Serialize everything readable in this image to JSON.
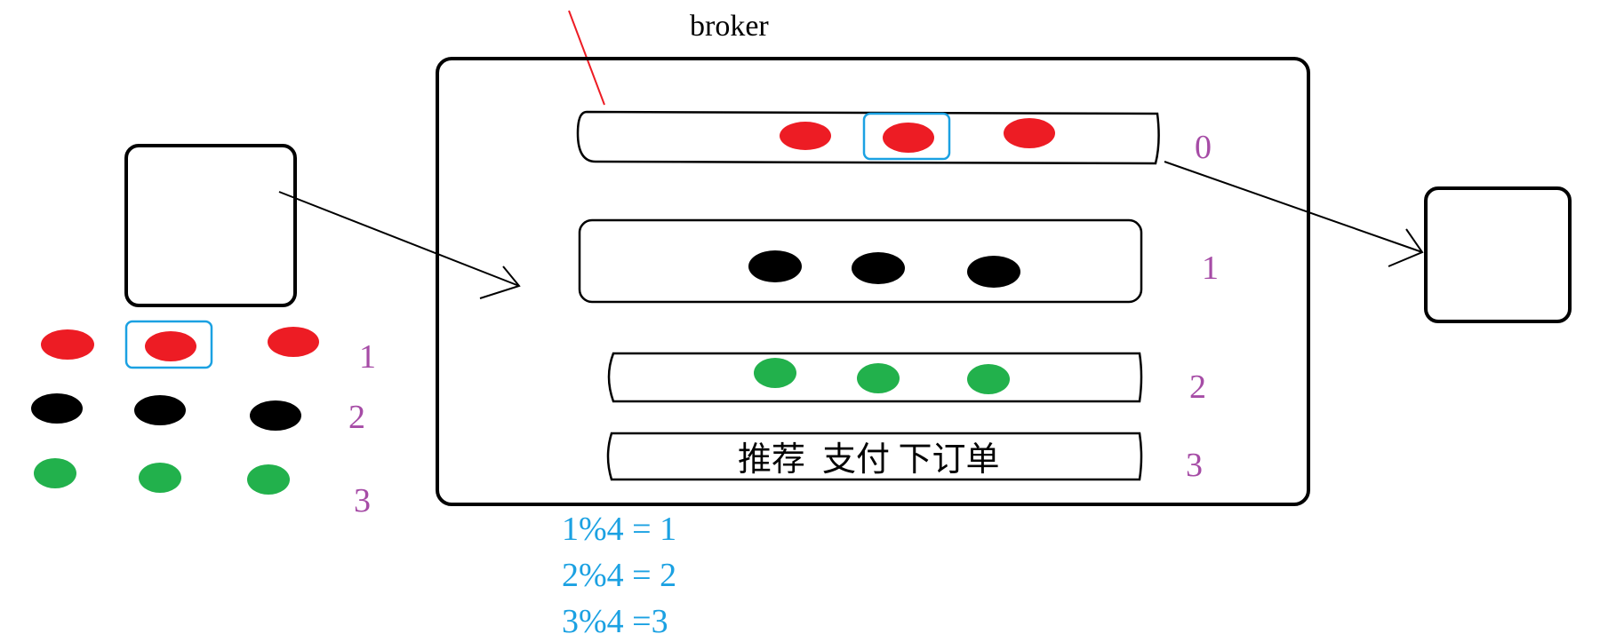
{
  "title": "broker",
  "colors": {
    "red": "#ed1c24",
    "black": "#000000",
    "green": "#22b14c",
    "blue_highlight": "#1ba1e2",
    "purple_label": "#a64ca6",
    "red_line": "#ed1c24"
  },
  "queues": [
    {
      "index": "0",
      "dot_color": "red",
      "dots": 3,
      "highlighted_dot": 1
    },
    {
      "index": "1",
      "dot_color": "black",
      "dots": 3
    },
    {
      "index": "2",
      "dot_color": "green",
      "dots": 3
    },
    {
      "index": "3",
      "text": "推荐  支付 下订单"
    }
  ],
  "producer_groups": [
    {
      "label": "1",
      "dot_color": "red",
      "dots": 3,
      "highlighted_dot": 1
    },
    {
      "label": "2",
      "dot_color": "black",
      "dots": 3
    },
    {
      "label": "3",
      "dot_color": "green",
      "dots": 3
    }
  ],
  "modulo_lines": [
    "1%4 = 1",
    "2%4 = 2",
    "3%4 =3"
  ]
}
